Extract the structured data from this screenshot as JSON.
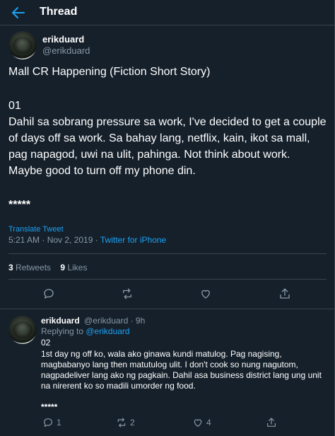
{
  "header": {
    "title": "Thread"
  },
  "tweet": {
    "author_name": "erikduard",
    "author_handle": "@erikduard",
    "title_line": "Mall CR Happening (Fiction Short Story)",
    "part": "01",
    "body": "Dahil sa sobrang pressure sa work, I've decided to get a couple of days off sa work. Sa bahay lang, netflix, kain, ikot sa mall, pag napagod, uwi na ulit, pahinga. Not think about work. Maybe good to turn off my phone din.",
    "stars": "*****",
    "translate_label": "Translate Tweet",
    "time": "5:21 AM · Nov 2, 2019 · ",
    "source": "Twitter for iPhone",
    "retweets": "3",
    "retweets_label": "Retweets",
    "likes": "9",
    "likes_label": "Likes"
  },
  "reply": {
    "author_name": "erikduard",
    "author_handle_time": "@erikduard · 9h",
    "replying_prefix": "Replying to ",
    "replying_to": "@erikduard",
    "part": "02",
    "body": "1st day ng off ko, wala ako ginawa kundi matulog. Pag nagising, magbabanyo lang then matutulog ulit. I don't cook so nung nagutom, nagpadeliver lang ako ng pagkain. Dahil asa business district lang ung unit na nirerent ko so madili umorder ng food.",
    "stars": "*****",
    "reply_count": "1",
    "retweet_count": "2",
    "like_count": "4"
  },
  "colors": {
    "background": "#15202b",
    "accent": "#1da1f2",
    "muted": "#8899a6",
    "border": "#38444d"
  },
  "icons": [
    "back-arrow-icon",
    "reply-icon",
    "retweet-icon",
    "like-icon",
    "share-icon"
  ]
}
